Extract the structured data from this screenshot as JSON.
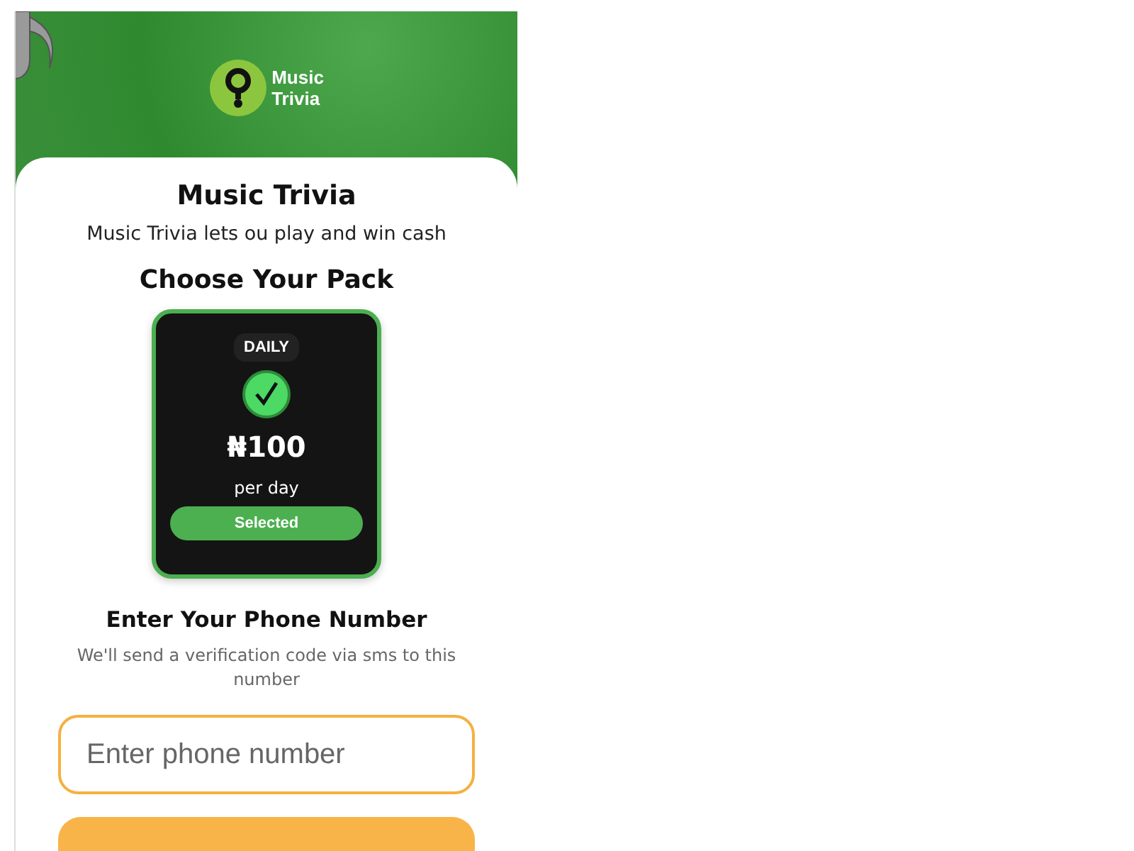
{
  "banner": {
    "logo_text_1": "Music",
    "logo_text_2": "Trivia"
  },
  "title": "Music Trivia",
  "subtitle": "Music Trivia lets ou play and win cash",
  "packs_heading": "Choose Your Pack",
  "packs": [
    {
      "period": "DAILY",
      "price": "₦100",
      "unit": "per day",
      "status": "Selected",
      "selected": true
    }
  ],
  "phone_heading": "Enter Your Phone Number",
  "phone_note": "We'll send a verification code via sms to this number",
  "phone_field": {
    "placeholder": "Enter phone number"
  }
}
